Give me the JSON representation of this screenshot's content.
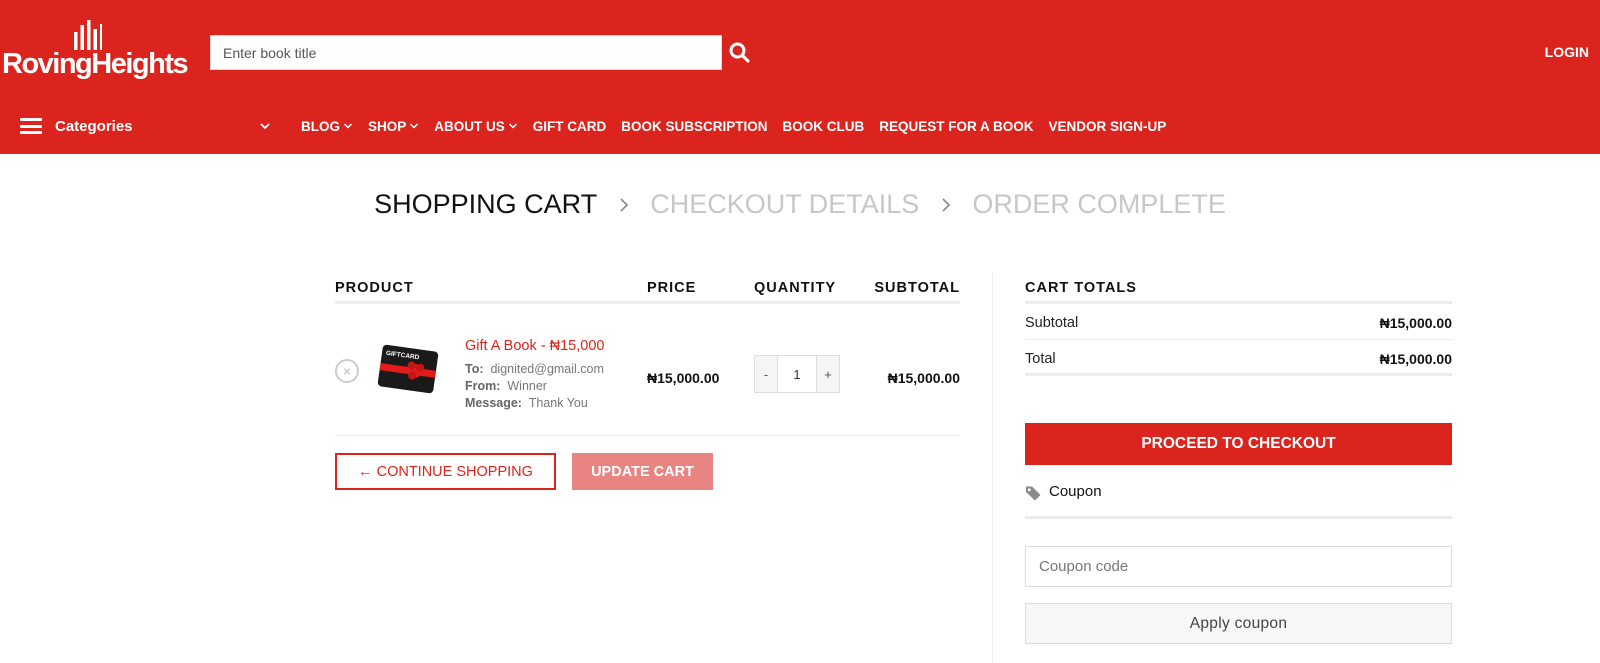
{
  "brand": {
    "name": "RovingHeights",
    "logo_icon": "sound-bars-logo"
  },
  "search": {
    "placeholder": "Enter book title",
    "value": "",
    "icon": "search-icon"
  },
  "header": {
    "login_label": "LOGIN"
  },
  "nav": {
    "categories_label": "Categories",
    "items": [
      {
        "label": "BLOG",
        "has_dropdown": true
      },
      {
        "label": "SHOP",
        "has_dropdown": true
      },
      {
        "label": "ABOUT US",
        "has_dropdown": true
      },
      {
        "label": "GIFT CARD",
        "has_dropdown": false
      },
      {
        "label": "BOOK SUBSCRIPTION",
        "has_dropdown": false
      },
      {
        "label": "BOOK CLUB",
        "has_dropdown": false
      },
      {
        "label": "REQUEST FOR A BOOK",
        "has_dropdown": false
      },
      {
        "label": "VENDOR SIGN-UP",
        "has_dropdown": false
      }
    ]
  },
  "steps": {
    "step1": "SHOPPING CART",
    "step2": "CHECKOUT DETAILS",
    "step3": "ORDER COMPLETE",
    "active_step": 1
  },
  "cart": {
    "headers": {
      "product": "PRODUCT",
      "price": "PRICE",
      "quantity": "QUANTITY",
      "subtotal": "SUBTOTAL"
    },
    "items": [
      {
        "name": "Gift A Book - ₦15,000",
        "thumb_text": "GIFTCARD",
        "to_label": "To:",
        "to_value": "dignited@gmail.com",
        "from_label": "From:",
        "from_value": "Winner",
        "message_label": "Message:",
        "message_value": "Thank You",
        "price": "₦15,000.00",
        "quantity": "1",
        "subtotal": "₦15,000.00",
        "remove_symbol": "×",
        "minus": "-",
        "plus": "+"
      }
    ],
    "continue_label": "← CONTINUE SHOPPING",
    "update_label": "UPDATE CART"
  },
  "totals": {
    "title": "CART TOTALS",
    "subtotal_label": "Subtotal",
    "subtotal_value": "₦15,000.00",
    "total_label": "Total",
    "total_value": "₦15,000.00",
    "checkout_label": "PROCEED TO CHECKOUT",
    "coupon_label": "Coupon",
    "coupon_placeholder": "Coupon code",
    "apply_label": "Apply coupon"
  },
  "colors": {
    "brand_red": "#db241d",
    "update_button": "#e88582",
    "step_inactive": "#c7c7c7"
  }
}
